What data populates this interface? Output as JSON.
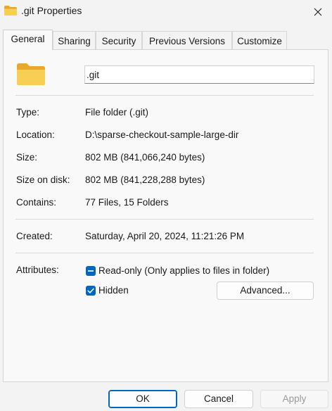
{
  "window": {
    "title": ".git Properties"
  },
  "tabs": [
    {
      "label": "General"
    },
    {
      "label": "Sharing"
    },
    {
      "label": "Security"
    },
    {
      "label": "Previous Versions"
    },
    {
      "label": "Customize"
    }
  ],
  "general": {
    "name_value": ".git",
    "type_label": "Type:",
    "type_value": "File folder (.git)",
    "location_label": "Location:",
    "location_value": "D:\\sparse-checkout-sample-large-dir",
    "size_label": "Size:",
    "size_value": "802 MB (841,066,240 bytes)",
    "size_on_disk_label": "Size on disk:",
    "size_on_disk_value": "802 MB (841,228,288 bytes)",
    "contains_label": "Contains:",
    "contains_value": "77 Files, 15 Folders",
    "created_label": "Created:",
    "created_value": "Saturday, April 20, 2024, 11:21:26 PM",
    "attributes_label": "Attributes:",
    "readonly_label": "Read-only (Only applies to files in folder)",
    "readonly_state": "indeterminate",
    "hidden_label": "Hidden",
    "hidden_state": "checked",
    "advanced_button": "Advanced..."
  },
  "footer": {
    "ok": "OK",
    "cancel": "Cancel",
    "apply": "Apply"
  },
  "colors": {
    "accent": "#0067c0",
    "folder": "#f6c74a"
  }
}
